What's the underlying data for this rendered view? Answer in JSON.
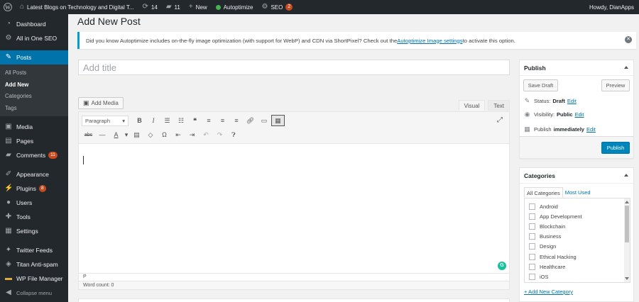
{
  "adminbar": {
    "site_name": "Latest Blogs on Technology and Digital T...",
    "updates_count": "14",
    "comments_count": "11",
    "new_label": "New",
    "autoptimize_label": "Autoptimize",
    "seo_label": "SEO",
    "seo_badge": "2",
    "howdy": "Howdy, DianApps"
  },
  "sidebar": {
    "dashboard": "Dashboard",
    "all_in_one_seo": "All in One SEO",
    "posts": "Posts",
    "posts_sub": [
      "All Posts",
      "Add New",
      "Categories",
      "Tags"
    ],
    "media": "Media",
    "pages": "Pages",
    "comments": "Comments",
    "comments_badge": "11",
    "appearance": "Appearance",
    "plugins": "Plugins",
    "plugins_badge": "8",
    "users": "Users",
    "tools": "Tools",
    "settings": "Settings",
    "twitter_feeds": "Twitter Feeds",
    "titan_anti_spam": "Titan Anti-spam",
    "wp_file_manager": "WP File Manager",
    "collapse_menu": "Collapse menu"
  },
  "page": {
    "title": "Add New Post"
  },
  "notice": {
    "text_before": "Did you know Autoptimize includes on-the-fly image optimization (with support for WebP) and CDN via ShortPixel? Check out the ",
    "link": "Autoptimize Image settings",
    "text_after": " to activate this option."
  },
  "title_input": {
    "placeholder": "Add title"
  },
  "editor": {
    "add_media": "Add Media",
    "tab_visual": "Visual",
    "tab_text": "Text",
    "format_select": "Paragraph",
    "status_path": "P",
    "word_count": "Word count: 0"
  },
  "publish": {
    "heading": "Publish",
    "save_draft": "Save Draft",
    "preview": "Preview",
    "status_label": "Status:",
    "status_value": "Draft",
    "visibility_label": "Visibility:",
    "visibility_value": "Public",
    "publish_label": "Publish",
    "publish_value": "immediately",
    "edit": "Edit",
    "publish_button": "Publish"
  },
  "categories": {
    "heading": "Categories",
    "tab_all": "All Categories",
    "tab_most_used": "Most Used",
    "items": [
      "Android",
      "App Development",
      "Blockchain",
      "Business",
      "Design",
      "Ethical Hacking",
      "Healthcare",
      "iOS"
    ],
    "add_new": "+ Add New Category"
  },
  "colors": {
    "admin_dark": "#23282d",
    "accent_blue": "#0073aa",
    "badge_orange": "#ca4a1f",
    "notice_blue": "#00a0d2"
  }
}
